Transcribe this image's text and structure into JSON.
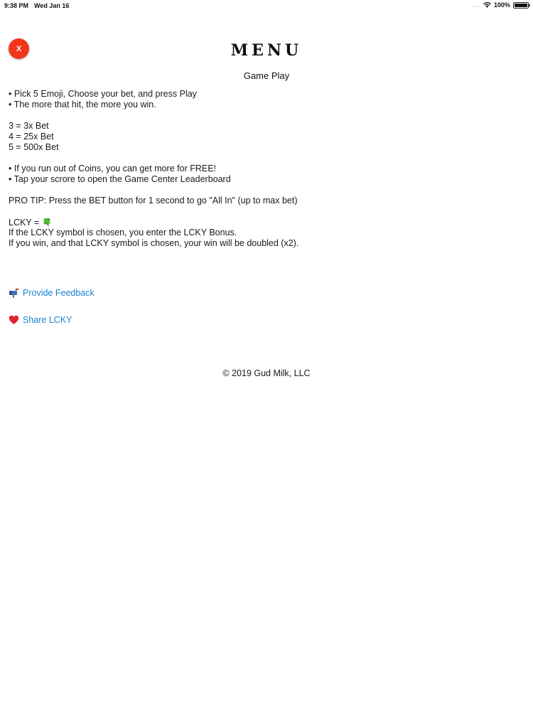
{
  "status_bar": {
    "time": "9:38 PM",
    "date": "Wed Jan 16",
    "signal": "....",
    "battery": "100%"
  },
  "close_button": {
    "label": "X",
    "color": "#f2361a"
  },
  "title": "MENU",
  "section_heading": "Game Play",
  "lines": {
    "l1": "• Pick 5 Emoji, Choose your bet, and press Play",
    "l2": "• The more that hit, the more you win.",
    "l3": "3 = 3x Bet",
    "l4": "4 = 25x Bet",
    "l5": "5 = 500x Bet",
    "l6": "• If you run out of Coins, you can get more for FREE!",
    "l7": "• Tap your scrore to open the Game Center Leaderboard",
    "l8": "PRO TIP: Press the BET button for 1 second to go \"All In\" (up to max bet)",
    "l9": "LCKY = ",
    "l10": "If the LCKY symbol is chosen, you enter the LCKY Bonus.",
    "l11": "If you win, and that LCKY symbol is chosen, your win will be doubled (x2)."
  },
  "icons": {
    "lcky_symbol": "four-leaf-clover-icon",
    "feedback": "mailbox-icon",
    "share": "heart-icon"
  },
  "links": {
    "feedback": "Provide Feedback",
    "share": "Share LCKY",
    "color": "#1a83d6"
  },
  "copyright": "© 2019 Gud Milk, LLC"
}
